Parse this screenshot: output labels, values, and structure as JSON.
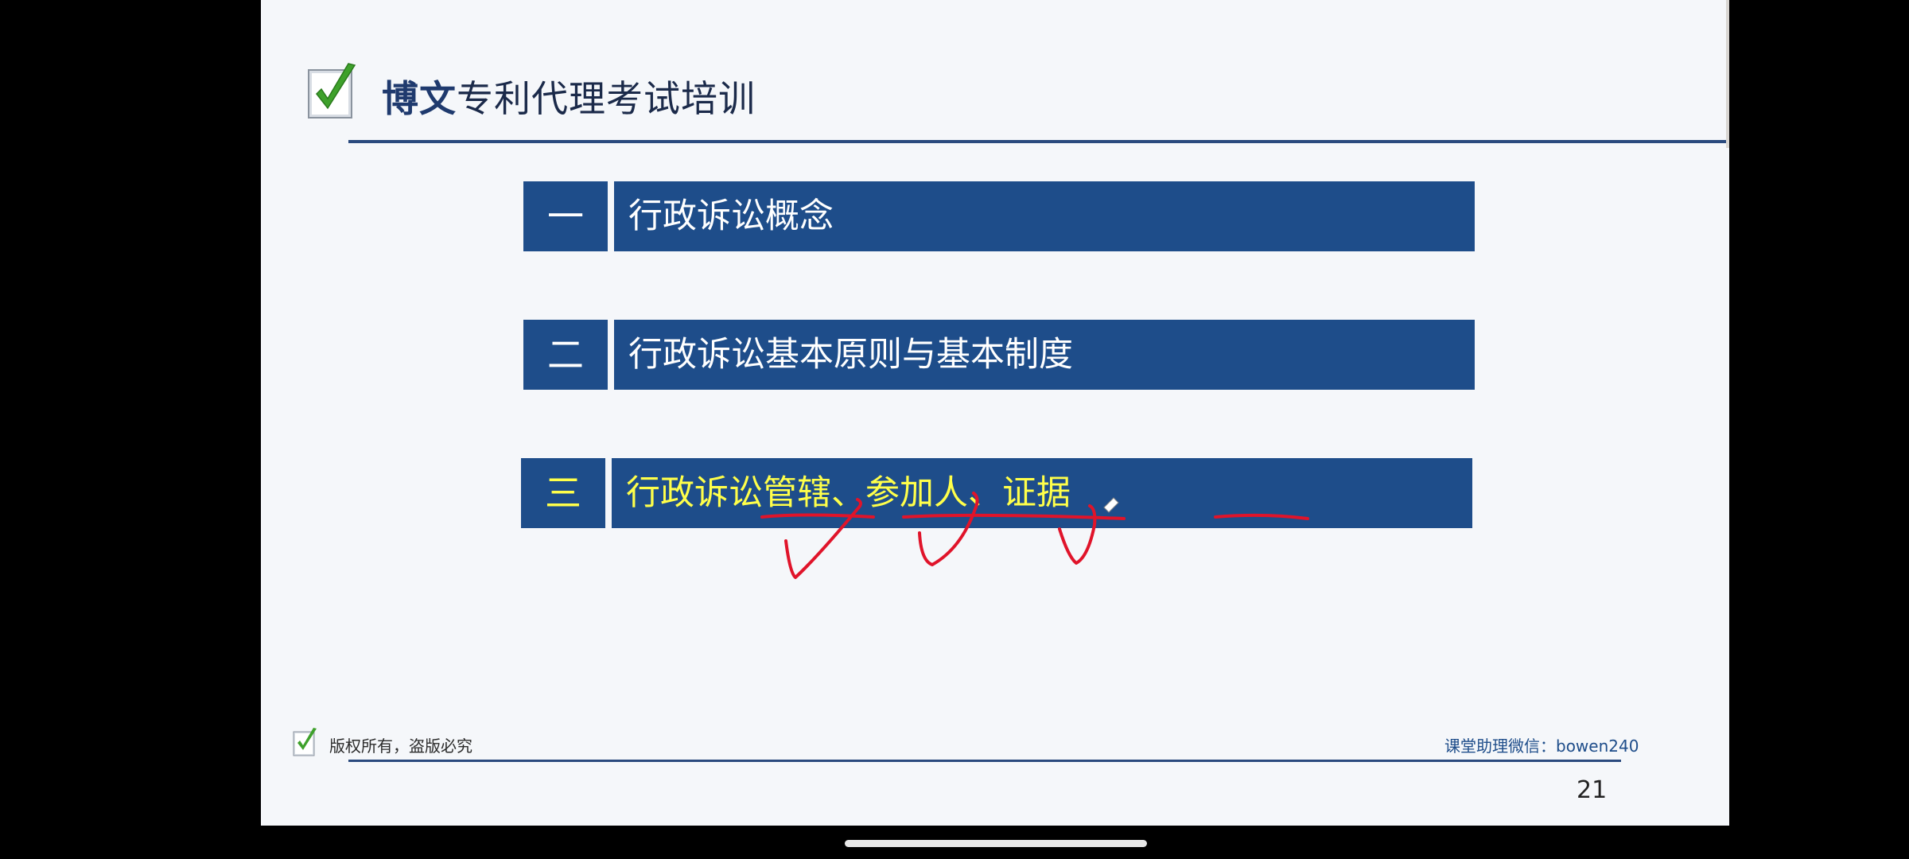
{
  "header": {
    "brand_bold": "博文",
    "brand_rest": "专利代理考试培训"
  },
  "outline": [
    {
      "number": "一",
      "title": "行政诉讼概念"
    },
    {
      "number": "二",
      "title": "行政诉讼基本原则与基本制度"
    },
    {
      "number": "三",
      "title_parts": [
        "行政诉讼管辖",
        "、",
        "参加人",
        "、",
        "证据"
      ]
    }
  ],
  "footer": {
    "copyright": "版权所有，盗版必究",
    "assistant": "课堂助理微信：bowen240",
    "page_number": "21"
  },
  "colors": {
    "bar": "#1e4d8a",
    "highlight_text": "#ffff4a",
    "annotation_ink": "#e0142a",
    "header_rule": "#2a4a7e"
  },
  "icons": {
    "logo": "checkmark-box-icon",
    "footer_logo": "checkmark-box-icon"
  }
}
